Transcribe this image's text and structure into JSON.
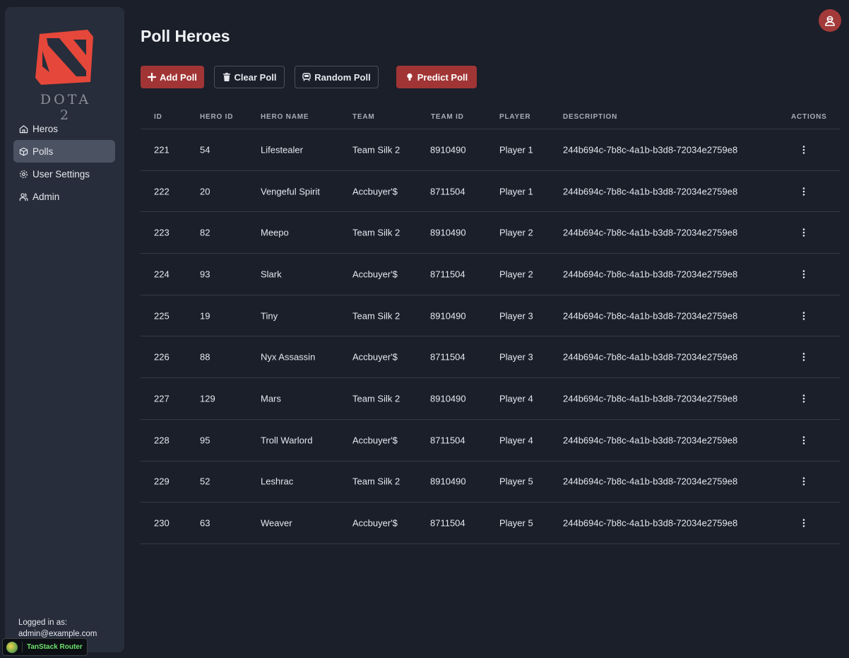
{
  "sidebar": {
    "logo_text": "DOTA 2",
    "nav": [
      {
        "label": "Heros",
        "icon": "home-icon",
        "active": false
      },
      {
        "label": "Polls",
        "icon": "cube-icon",
        "active": true
      },
      {
        "label": "User Settings",
        "icon": "gear-icon",
        "active": false
      },
      {
        "label": "Admin",
        "icon": "users-icon",
        "active": false
      }
    ],
    "logged_label": "Logged in as:",
    "logged_user": "admin@example.com"
  },
  "devtools": {
    "label": "TanStack Router"
  },
  "page": {
    "title": "Poll Heroes",
    "buttons": {
      "add": "Add Poll",
      "clear": "Clear Poll",
      "random": "Random Poll",
      "predict": "Predict Poll"
    }
  },
  "colors": {
    "accent": "#a13535",
    "background": "#1b1f2a",
    "sidebar": "#272d3a"
  },
  "table": {
    "headers": [
      "ID",
      "HERO ID",
      "HERO NAME",
      "TEAM",
      "TEAM ID",
      "PLAYER",
      "DESCRIPTION",
      "ACTIONS"
    ],
    "rows": [
      [
        "221",
        "54",
        "Lifestealer",
        "Team Silk 2",
        "8910490",
        "Player 1",
        "244b694c-7b8c-4a1b-b3d8-72034e2759e8"
      ],
      [
        "222",
        "20",
        "Vengeful Spirit",
        "Accbuyer'$",
        "8711504",
        "Player 1",
        "244b694c-7b8c-4a1b-b3d8-72034e2759e8"
      ],
      [
        "223",
        "82",
        "Meepo",
        "Team Silk 2",
        "8910490",
        "Player 2",
        "244b694c-7b8c-4a1b-b3d8-72034e2759e8"
      ],
      [
        "224",
        "93",
        "Slark",
        "Accbuyer'$",
        "8711504",
        "Player 2",
        "244b694c-7b8c-4a1b-b3d8-72034e2759e8"
      ],
      [
        "225",
        "19",
        "Tiny",
        "Team Silk 2",
        "8910490",
        "Player 3",
        "244b694c-7b8c-4a1b-b3d8-72034e2759e8"
      ],
      [
        "226",
        "88",
        "Nyx Assassin",
        "Accbuyer'$",
        "8711504",
        "Player 3",
        "244b694c-7b8c-4a1b-b3d8-72034e2759e8"
      ],
      [
        "227",
        "129",
        "Mars",
        "Team Silk 2",
        "8910490",
        "Player 4",
        "244b694c-7b8c-4a1b-b3d8-72034e2759e8"
      ],
      [
        "228",
        "95",
        "Troll Warlord",
        "Accbuyer'$",
        "8711504",
        "Player 4",
        "244b694c-7b8c-4a1b-b3d8-72034e2759e8"
      ],
      [
        "229",
        "52",
        "Leshrac",
        "Team Silk 2",
        "8910490",
        "Player 5",
        "244b694c-7b8c-4a1b-b3d8-72034e2759e8"
      ],
      [
        "230",
        "63",
        "Weaver",
        "Accbuyer'$",
        "8711504",
        "Player 5",
        "244b694c-7b8c-4a1b-b3d8-72034e2759e8"
      ]
    ]
  }
}
